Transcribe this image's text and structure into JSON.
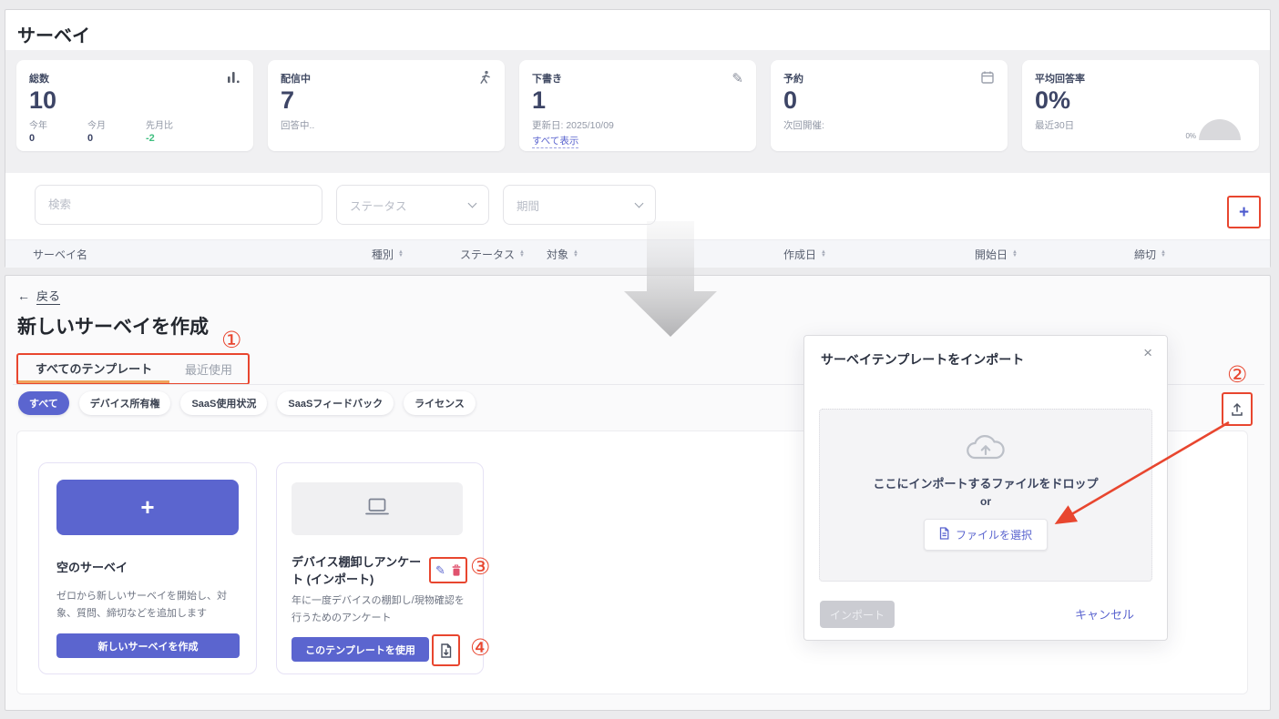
{
  "colors": {
    "accent": "#5b65cf",
    "annotation_red": "#e8462f",
    "tab_active_underline": "#f0a35c",
    "positive_green": "#3fbf7f",
    "page_bg": "#ebebed"
  },
  "dashboard": {
    "title": "サーベイ",
    "cards": [
      {
        "label": "総数",
        "value": "10",
        "icon": "bar-chart-icon",
        "subs": [
          {
            "label": "今年",
            "value": "0"
          },
          {
            "label": "今月",
            "value": "0"
          },
          {
            "label": "先月比",
            "value": "-2"
          }
        ]
      },
      {
        "label": "配信中",
        "value": "7",
        "icon": "runner-icon",
        "note": "回答中.."
      },
      {
        "label": "下書き",
        "value": "1",
        "icon": "pencil-icon",
        "note": "更新日: 2025/10/09",
        "link": "すべて表示"
      },
      {
        "label": "予約",
        "value": "0",
        "icon": "calendar-icon",
        "note": "次回開催:"
      },
      {
        "label": "平均回答率",
        "value": "0%",
        "note": "最近30日",
        "gauge_label": "0%"
      }
    ],
    "search_placeholder": "検索",
    "status_filter": "ステータス",
    "period_filter": "期間",
    "add_button_label": "+",
    "table_headers": [
      {
        "label": "サーベイ名"
      },
      {
        "label": "種別"
      },
      {
        "label": "ステータス"
      },
      {
        "label": "対象"
      },
      {
        "label": "作成日"
      },
      {
        "label": "開始日"
      },
      {
        "label": "締切"
      }
    ]
  },
  "create_page": {
    "back_arrow": "←",
    "back_label": "戻る",
    "title": "新しいサーベイを作成",
    "tabs": [
      {
        "label": "すべてのテンプレート",
        "active": true
      },
      {
        "label": "最近使用",
        "active": false
      }
    ],
    "chips": [
      {
        "label": "すべて",
        "active": true
      },
      {
        "label": "デバイス所有権"
      },
      {
        "label": "SaaS使用状況"
      },
      {
        "label": "SaaSフィードバック"
      },
      {
        "label": "ライセンス"
      }
    ],
    "blank_card": {
      "plus": "+",
      "title": "空のサーベイ",
      "description": "ゼロから新しいサーベイを開始し、対象、質問、締切などを追加します",
      "button": "新しいサーベイを作成"
    },
    "template_card": {
      "title": "デバイス棚卸しアンケート (インポート)",
      "description": "年に一度デバイスの棚卸し/現物確認を行うためのアンケート",
      "button": "このテンプレートを使用"
    }
  },
  "import_modal": {
    "title": "サーベイテンプレートをインポート",
    "close": "×",
    "drop_text": "ここにインポートするファイルをドロップ",
    "or_text": "or",
    "select_file_button": "ファイルを選択",
    "import_button": "インポート",
    "cancel_button": "キャンセル"
  },
  "annotations": {
    "n1": "①",
    "n2": "②",
    "n3": "③",
    "n4": "④"
  }
}
